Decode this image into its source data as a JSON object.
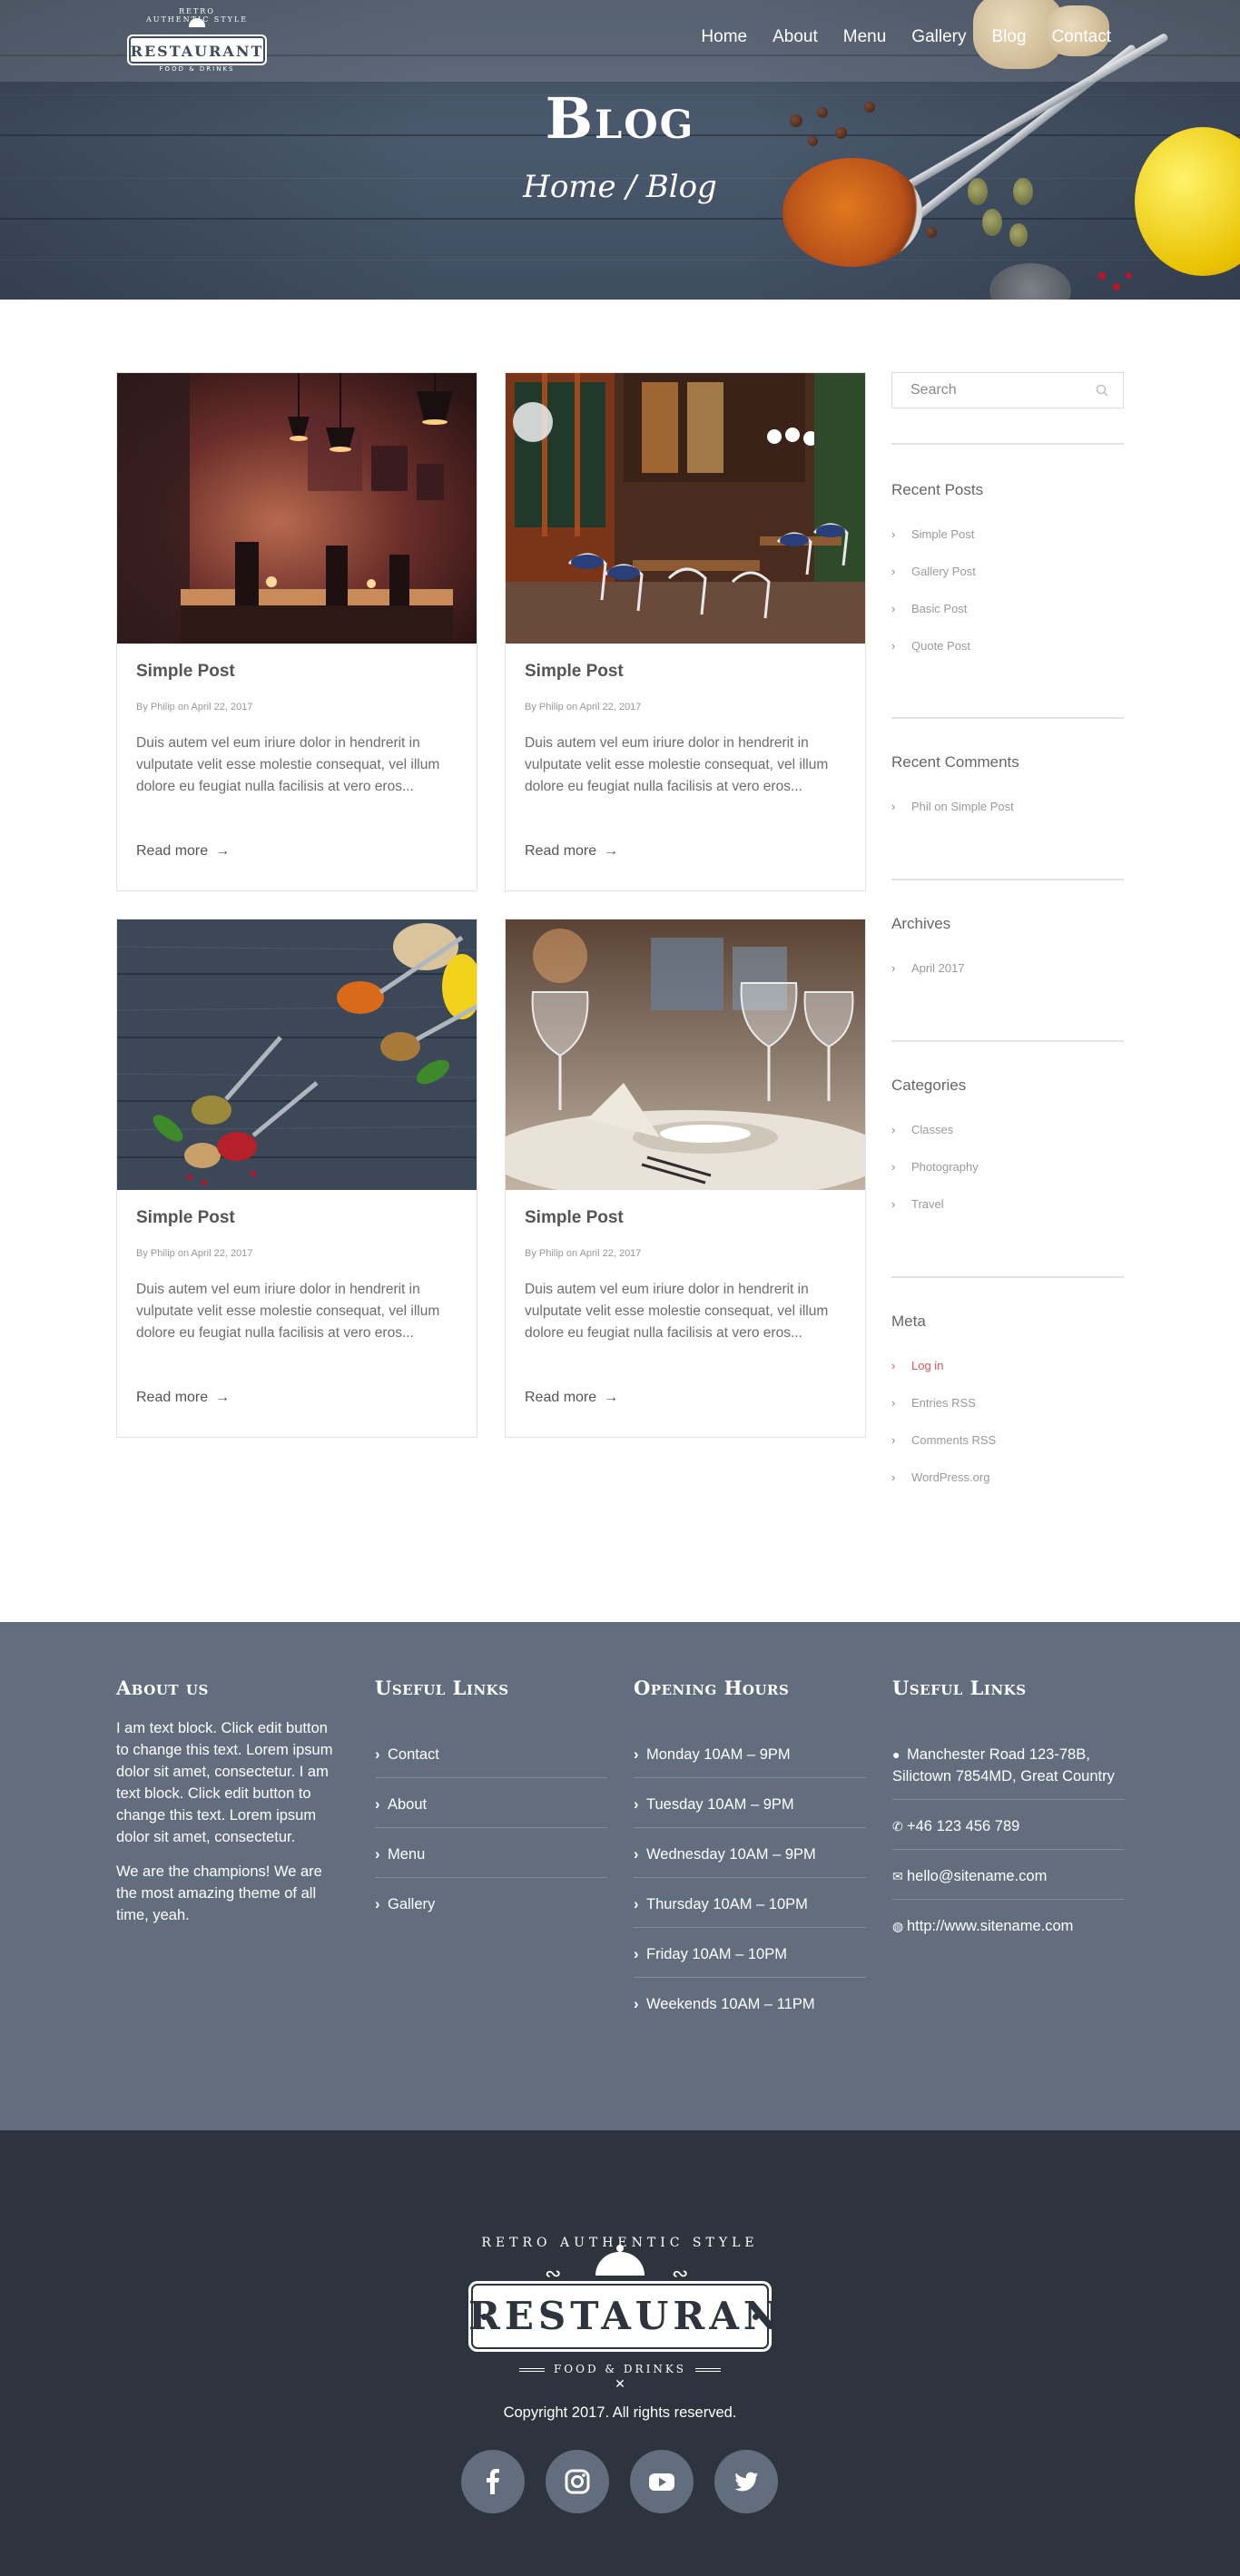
{
  "header": {
    "logo": {
      "arc_text": "RETRO AUTHENTIC STYLE",
      "name": "RESTAURANT",
      "sub": "FOOD & DRINKS"
    },
    "nav": [
      {
        "label": "Home"
      },
      {
        "label": "About"
      },
      {
        "label": "Menu"
      },
      {
        "label": "Gallery"
      },
      {
        "label": "Blog"
      },
      {
        "label": "Contact"
      }
    ],
    "title": "Blog",
    "breadcrumb": "Home / Blog"
  },
  "posts": [
    {
      "title": "Simple Post",
      "meta": "By Philip on April 22, 2017",
      "excerpt": "Duis autem vel eum iriure dolor in hendrerit in vulputate velit esse molestie consequat, vel illum dolore eu feugiat nulla facilisis at vero eros...",
      "more": "Read more",
      "image": "restaurant-interior-photo"
    },
    {
      "title": "Simple Post",
      "meta": "By Philip on April 22, 2017",
      "excerpt": "Duis autem vel eum iriure dolor in hendrerit in vulputate velit esse molestie consequat, vel illum dolore eu feugiat nulla facilisis at vero eros...",
      "more": "Read more",
      "image": "cafe-terrace-photo"
    },
    {
      "title": "Simple Post",
      "meta": "By Philip on April 22, 2017",
      "excerpt": "Duis autem vel eum iriure dolor in hendrerit in vulputate velit esse molestie consequat, vel illum dolore eu feugiat nulla facilisis at vero eros...",
      "more": "Read more",
      "image": "spices-on-wood-photo"
    },
    {
      "title": "Simple Post",
      "meta": "By Philip on April 22, 2017",
      "excerpt": "Duis autem vel eum iriure dolor in hendrerit in vulputate velit esse molestie consequat, vel illum dolore eu feugiat nulla facilisis at vero eros...",
      "more": "Read more",
      "image": "wine-glasses-table-photo"
    }
  ],
  "sidebar": {
    "search_placeholder": "Search",
    "recent_posts": {
      "title": "Recent Posts",
      "items": [
        "Simple Post",
        "Gallery Post",
        "Basic Post",
        "Quote Post"
      ]
    },
    "recent_comments": {
      "title": "Recent Comments",
      "items": [
        "Phil on Simple Post"
      ]
    },
    "archives": {
      "title": "Archives",
      "items": [
        "April 2017"
      ]
    },
    "categories": {
      "title": "Categories",
      "items": [
        "Classes",
        "Photography",
        "Travel"
      ]
    },
    "meta": {
      "title": "Meta",
      "items": [
        "Log in",
        "Entries RSS",
        "Comments RSS",
        "WordPress.org"
      ]
    }
  },
  "footer": {
    "about": {
      "title": "About us",
      "p1": "I am text block. Click edit button to change this text. Lorem ipsum dolor sit amet, consectetur. I am text block. Click edit button to change this text. Lorem ipsum dolor sit amet, consectetur.",
      "p2": "We are the champions! We are the most amazing theme of all time, yeah."
    },
    "useful_links": {
      "title": "Useful Links",
      "items": [
        "Contact",
        "About",
        "Menu",
        "Gallery"
      ]
    },
    "hours": {
      "title": "Opening Hours",
      "items": [
        "Monday 10AM – 9PM",
        "Tuesday 10AM – 9PM",
        "Wednesday 10AM – 9PM",
        "Thursday 10AM – 10PM",
        "Friday 10AM – 10PM",
        "Weekends 10AM – 11PM"
      ]
    },
    "contact": {
      "title": "Useful Links",
      "address": "Manchester Road 123-78B, Silictown 7854MD, Great Country",
      "phone": "+46 123 456 789",
      "email": "hello@sitename.com",
      "website": "http://www.sitename.com"
    },
    "copyright": "Copyright 2017. All rights reserved.",
    "social": [
      "facebook-icon",
      "instagram-icon",
      "youtube-icon",
      "twitter-icon"
    ]
  },
  "colors": {
    "accent": "#e0545a",
    "footer_top": "#626e7e",
    "footer_bottom": "#2e343d",
    "hero": "#4a596d"
  }
}
